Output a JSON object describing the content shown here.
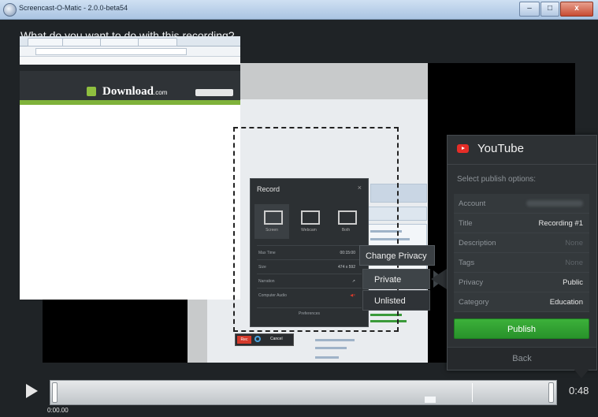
{
  "window": {
    "title": "Screencast-O-Matic - 2.0.0-beta54",
    "minimize": "–",
    "maximize": "□",
    "close": "x"
  },
  "prompt": "What do you want to do with this recording?",
  "screenshot": {
    "site_logo": "Download",
    "site_domain": ".com",
    "record_panel": {
      "title": "Record",
      "close": "×",
      "options": [
        "Screen",
        "Webcam",
        "Both"
      ],
      "rows": [
        {
          "label": "Max Time",
          "value": "00:15:00"
        },
        {
          "label": "Size",
          "value": "474 x 592"
        },
        {
          "label": "Narration",
          "value": ""
        },
        {
          "label": "Computer Audio",
          "value": ""
        }
      ],
      "preferences": "Preferences"
    },
    "rec_bar": {
      "rec": "Rec",
      "cancel": "Cancel"
    }
  },
  "privacy_menu": {
    "header": "Change Privacy",
    "options": [
      "Private",
      "Unlisted"
    ],
    "selected": "Private"
  },
  "youtube": {
    "title": "YouTube",
    "subtitle": "Select publish options:",
    "rows": [
      {
        "label": "Account",
        "value": ""
      },
      {
        "label": "Title",
        "value": "Recording #1"
      },
      {
        "label": "Description",
        "value": "None"
      },
      {
        "label": "Tags",
        "value": "None"
      },
      {
        "label": "Privacy",
        "value": "Public"
      },
      {
        "label": "Category",
        "value": "Education"
      }
    ],
    "publish": "Publish",
    "back": "Back"
  },
  "timeline": {
    "current_time": "0:00.00",
    "duration": "0:48"
  },
  "colors": {
    "publish": "#2e9f2e",
    "youtube_red": "#e52d27",
    "background": "#1f2326"
  }
}
